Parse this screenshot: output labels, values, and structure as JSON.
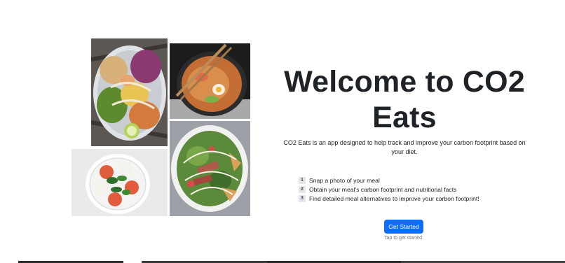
{
  "hero": {
    "title_line1": "Welcome to CO2",
    "title_line2": "Eats",
    "description": "CO2 Eats is an app designed to help track and improve your carbon footprint based on your diet."
  },
  "steps": [
    {
      "number": "1",
      "text": "Snap a photo of your meal"
    },
    {
      "number": "2",
      "text": "Obtain your meal's carbon footprint and nutritional facts"
    },
    {
      "number": "3",
      "text": "Find detailed meal alternatives to improve your carbon footprint!"
    }
  ],
  "cta": {
    "button_label": "Get Started",
    "hint": "Tap to get started."
  },
  "colors": {
    "primary": "#0d6efd",
    "heading": "#1f2328",
    "muted": "#6c757d"
  },
  "images": [
    {
      "icon": "shrimp-bowl-photo"
    },
    {
      "icon": "ramen-bowl-photo"
    },
    {
      "icon": "caprese-salad-photo"
    },
    {
      "icon": "steak-salad-photo"
    }
  ]
}
